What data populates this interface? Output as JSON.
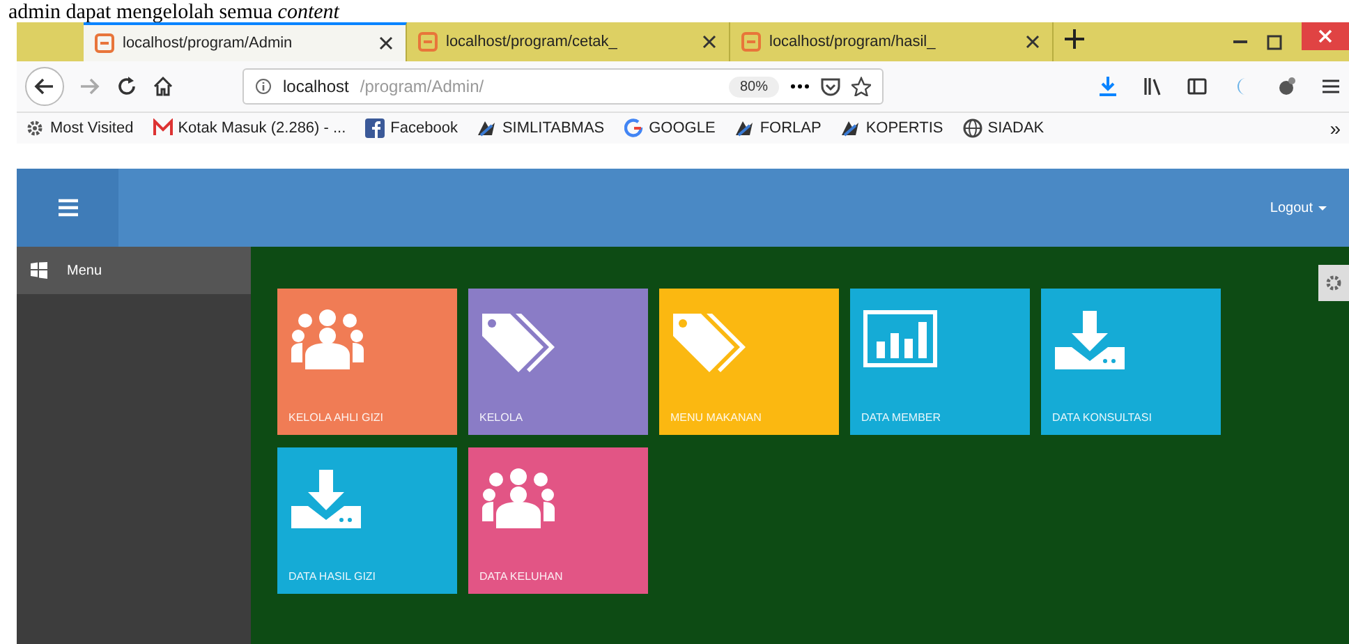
{
  "caption": "admin dapat mengelolah semua *content*",
  "tabs": [
    {
      "title": "localhost/program/Admin",
      "selected": true
    },
    {
      "title": "localhost/program/cetak_",
      "selected": false
    },
    {
      "title": "localhost/program/hasil_",
      "selected": false
    }
  ],
  "address": {
    "host": "localhost",
    "path": "/program/Admin/",
    "zoom": "80%"
  },
  "bookmarks": [
    {
      "label": "Most Visited",
      "kind": "gear"
    },
    {
      "label": "Kotak Masuk (2.286) - ...",
      "kind": "mail"
    },
    {
      "label": "Facebook",
      "kind": "facebook"
    },
    {
      "label": "SIMLITABMAS",
      "kind": "logo"
    },
    {
      "label": "GOOGLE",
      "kind": "google"
    },
    {
      "label": "FORLAP",
      "kind": "logo"
    },
    {
      "label": "KOPERTIS",
      "kind": "logo"
    },
    {
      "label": "SIADAK",
      "kind": "globe"
    }
  ],
  "bookmarks_more": "»",
  "header": {
    "user_menu": "Logout"
  },
  "sidebar": {
    "items": [
      {
        "label": "Menu",
        "selected": true
      }
    ]
  },
  "tiles": [
    {
      "label": "KELOLA AHLI GIZI",
      "kind": "people",
      "color": "#f07c55"
    },
    {
      "label": "KELOLA",
      "kind": "tags",
      "color": "#8a7cc6"
    },
    {
      "label": "MENU MAKANAN",
      "kind": "tags",
      "color": "#fbb811"
    },
    {
      "label": "DATA MEMBER",
      "kind": "chart",
      "color": "#15abd6"
    },
    {
      "label": "DATA KONSULTASI",
      "kind": "download",
      "color": "#15abd6"
    },
    {
      "label": "DATA HASIL GIZI",
      "kind": "download",
      "color": "#15abd6"
    },
    {
      "label": "DATA KELUHAN",
      "kind": "people",
      "color": "#e25585"
    }
  ]
}
